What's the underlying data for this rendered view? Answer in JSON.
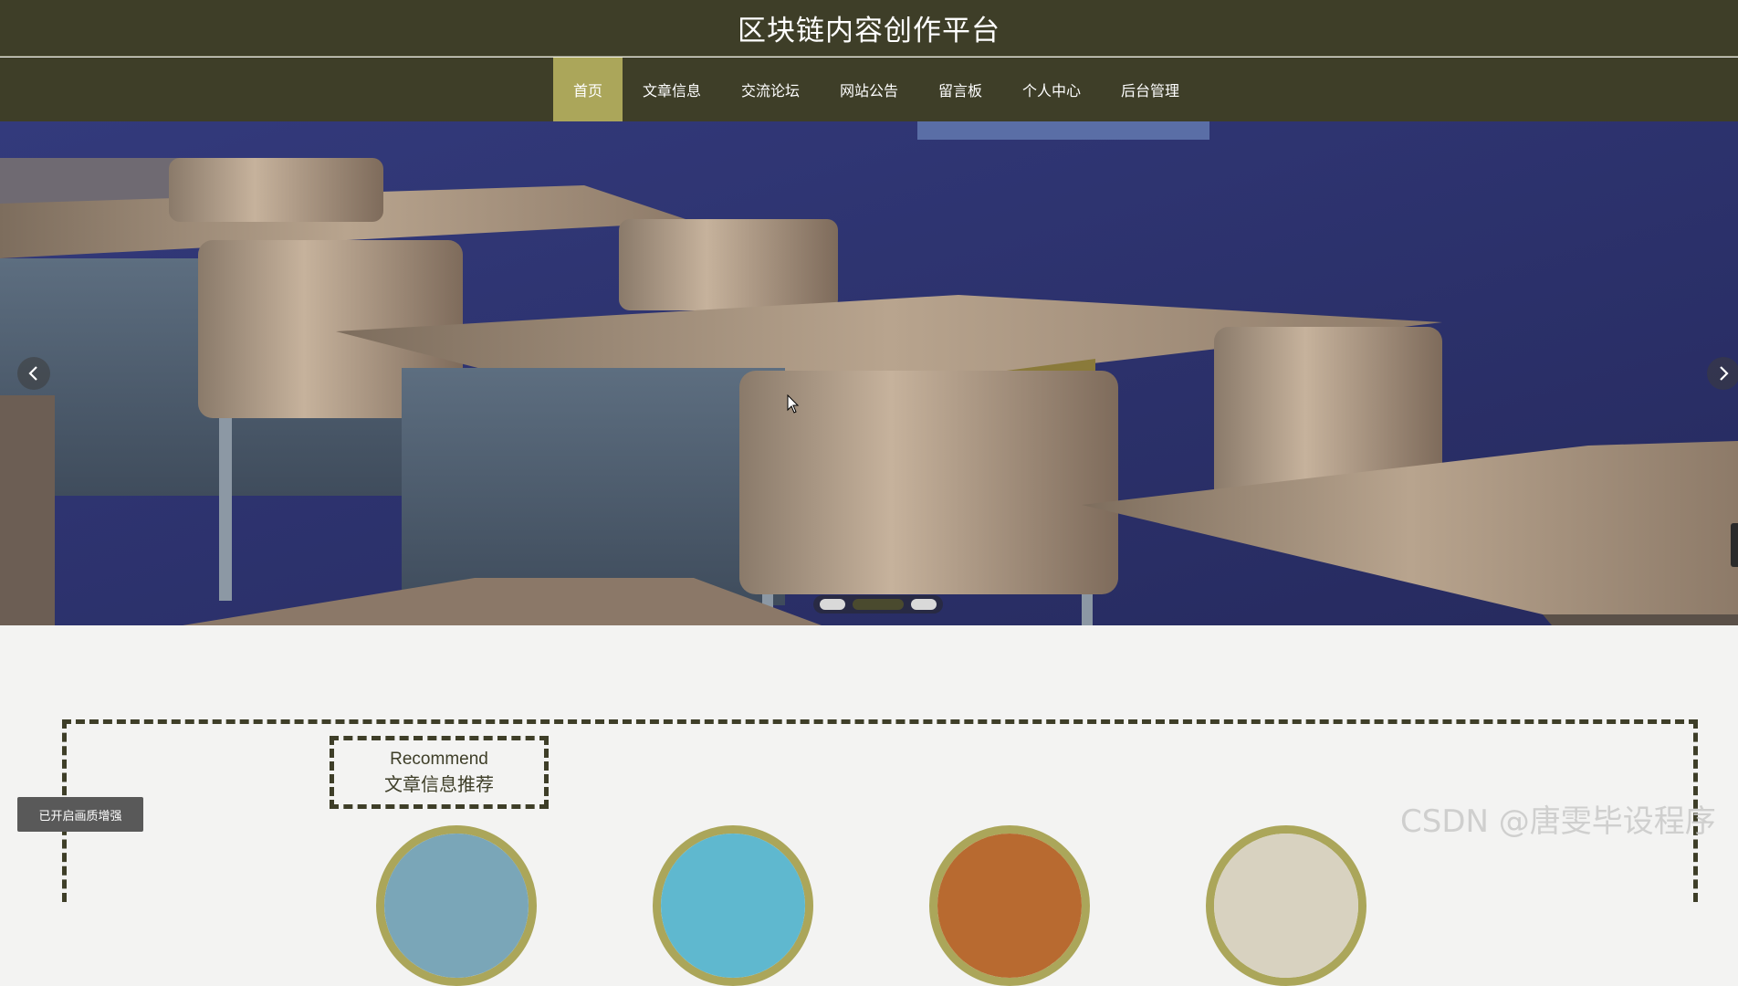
{
  "header": {
    "title": "区块链内容创作平台"
  },
  "nav": {
    "items": [
      {
        "label": "首页",
        "active": true
      },
      {
        "label": "文章信息",
        "active": false
      },
      {
        "label": "交流论坛",
        "active": false
      },
      {
        "label": "网站公告",
        "active": false
      },
      {
        "label": "留言板",
        "active": false
      },
      {
        "label": "个人中心",
        "active": false
      },
      {
        "label": "后台管理",
        "active": false
      }
    ]
  },
  "carousel": {
    "prev_icon": "chevron-left-icon",
    "next_icon": "chevron-right-icon",
    "slide_count": 3,
    "active_index": 1
  },
  "recommend": {
    "title_en": "Recommend",
    "title_zh": "文章信息推荐"
  },
  "overlay": {
    "quality_button": "已开启画质增强",
    "watermark": "CSDN @唐雯毕设程序"
  },
  "colors": {
    "header_bg": "#3e3e28",
    "accent": "#aba65a",
    "page_bg": "#f3f3f2"
  }
}
